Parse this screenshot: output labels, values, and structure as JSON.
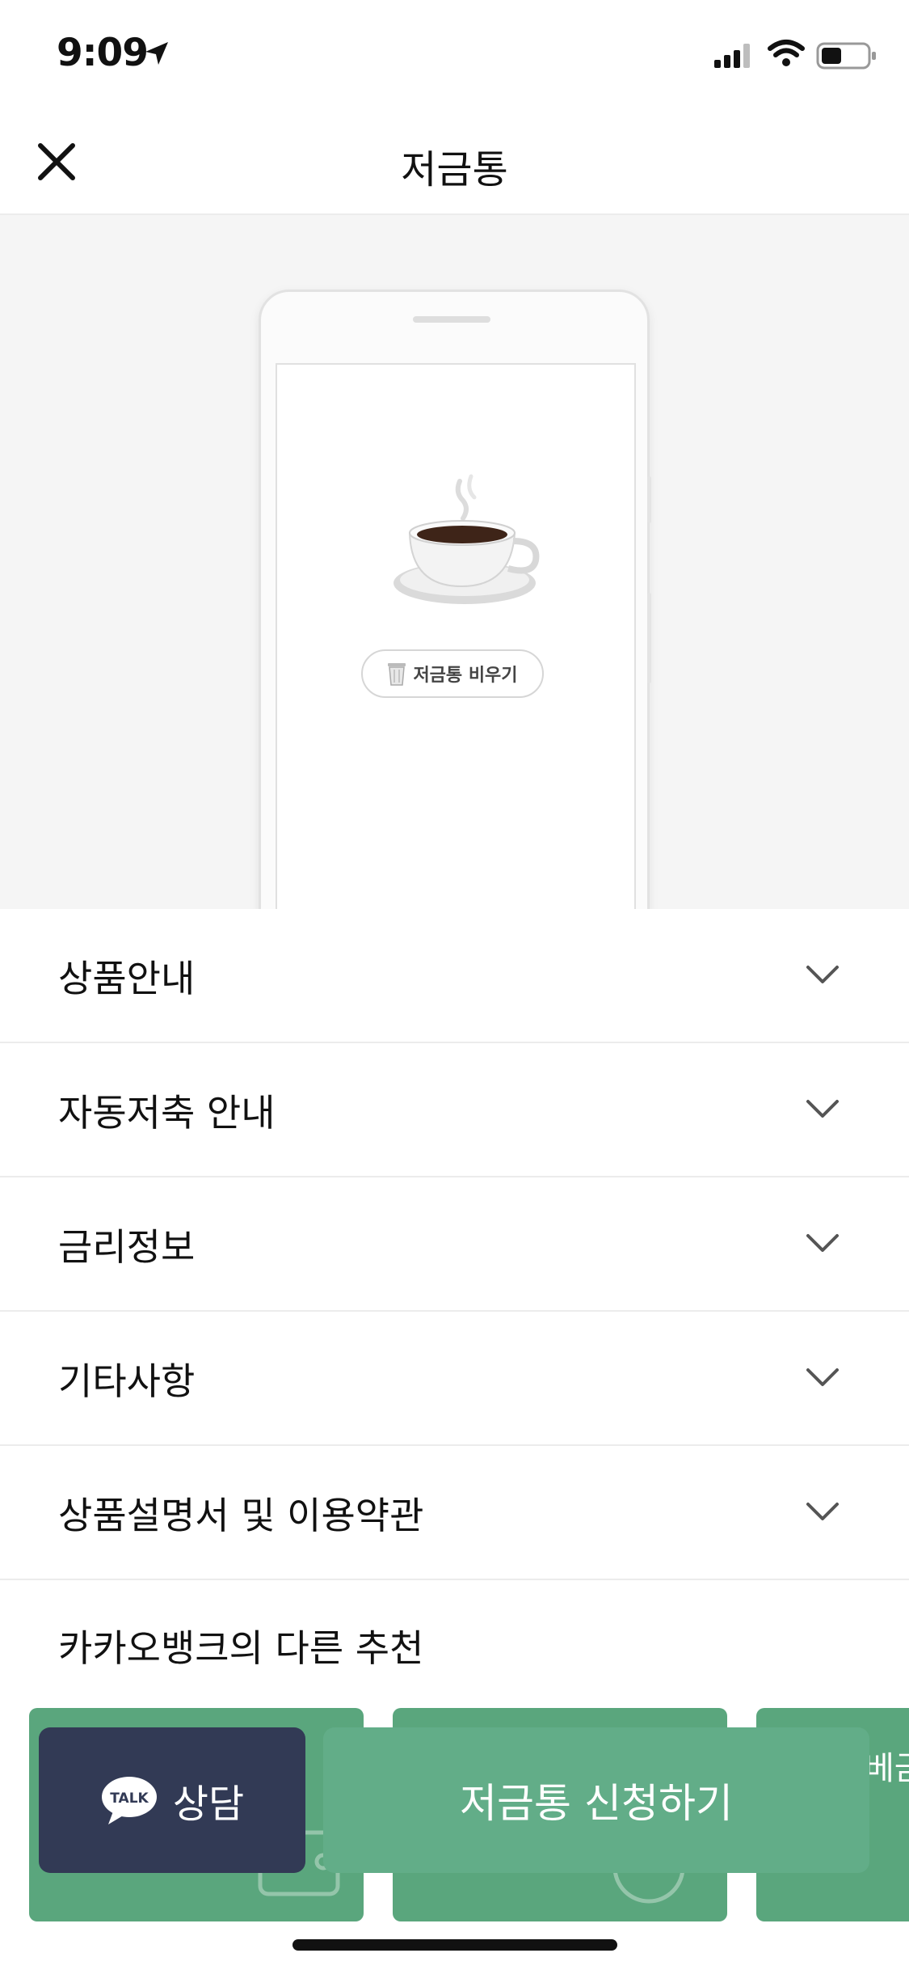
{
  "status_bar": {
    "time": "9:09"
  },
  "nav": {
    "title": "저금통"
  },
  "hero": {
    "empty_button_label": "저금통 비우기"
  },
  "sections": [
    {
      "label": "상품안내"
    },
    {
      "label": "자동저축 안내"
    },
    {
      "label": "금리정보"
    },
    {
      "label": "기타사항"
    },
    {
      "label": "상품설명서 및 이용약관"
    }
  ],
  "recommend": {
    "title": "카카오뱅크의 다른 추천",
    "card3_text": "베금"
  },
  "bottom": {
    "talk_badge": "TALK",
    "talk_label": "상담",
    "apply_label": "저금통 신청하기"
  },
  "colors": {
    "accent": "#5aa67d",
    "talk_bg": "#323a55",
    "apply_bg": "#62ad88"
  }
}
